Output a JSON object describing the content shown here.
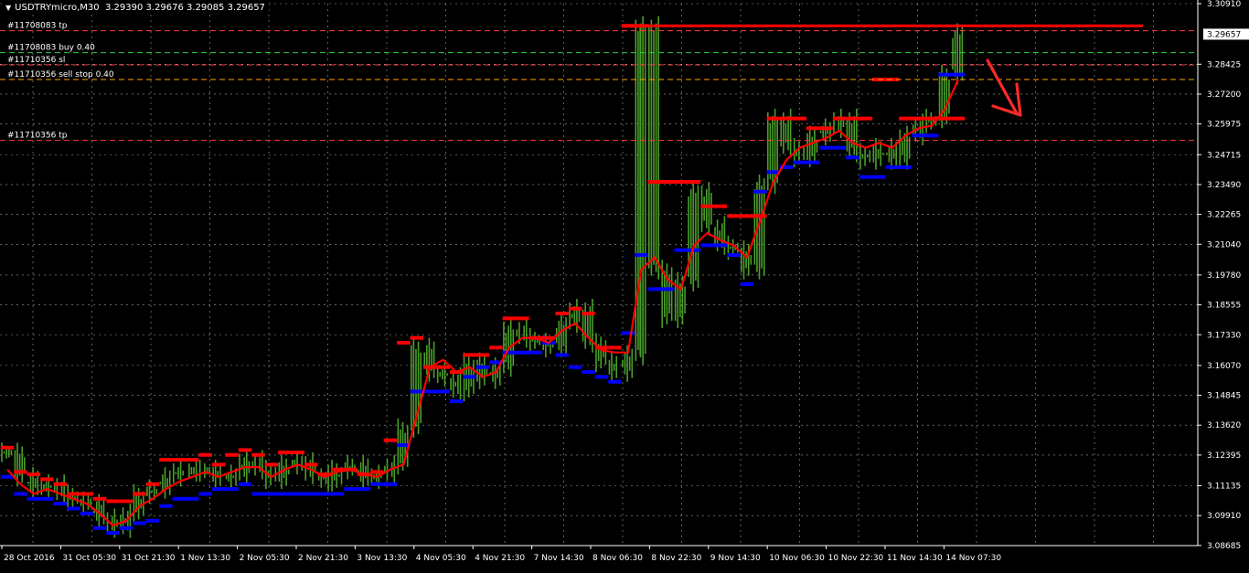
{
  "header": {
    "symbol": "USDTRYmicro,M30",
    "ohlc": "3.29390 3.29676 3.29085 3.29657"
  },
  "colors": {
    "background": "#000000",
    "grid": "#c8c8c8",
    "candle": "#4a9f2a",
    "resistance": "#ff0000",
    "support": "#0000ff",
    "ma": "#ff0000",
    "current_price_label_bg": "#ffffff"
  },
  "trade_lines": [
    {
      "label": "#11708083 tp",
      "price": 3.298,
      "color": "#ff3b3b",
      "style": "dashed"
    },
    {
      "label": "#11708083 buy 0.40",
      "price": 3.289,
      "color": "#2ecc40",
      "style": "dashed"
    },
    {
      "label": "#11710356 sl",
      "price": 3.284,
      "color": "#ff3b3b",
      "style": "dashed"
    },
    {
      "label": "#11710356 sell stop 0.40",
      "price": 3.278,
      "color": "#ffa500",
      "style": "dashed"
    },
    {
      "label": "#11710356 tp",
      "price": 3.253,
      "color": "#ff3b3b",
      "style": "dashed"
    }
  ],
  "current_price": "3.29657",
  "chart_data": {
    "type": "candlestick",
    "ylim": [
      3.0868,
      3.3091
    ],
    "y_ticks": [
      "3.30910",
      "3.28425",
      "3.27200",
      "3.25975",
      "3.24715",
      "3.23490",
      "3.22265",
      "3.21040",
      "3.19780",
      "3.18555",
      "3.17330",
      "3.16070",
      "3.14845",
      "3.13620",
      "3.12395",
      "3.11135",
      "3.09910",
      "3.08685"
    ],
    "y_tick_values": [
      3.3091,
      3.28425,
      3.272,
      3.25975,
      3.24715,
      3.2349,
      3.22265,
      3.2104,
      3.1978,
      3.18555,
      3.1733,
      3.1607,
      3.14845,
      3.1362,
      3.12395,
      3.11135,
      3.0991,
      3.08685
    ],
    "x_ticks": [
      "28 Oct 2016",
      "31 Oct 05:30",
      "31 Oct 21:30",
      "1 Nov 13:30",
      "2 Nov 05:30",
      "2 Nov 21:30",
      "3 Nov 13:30",
      "4 Nov 05:30",
      "4 Nov 21:30",
      "7 Nov 14:30",
      "8 Nov 06:30",
      "8 Nov 22:30",
      "9 Nov 14:30",
      "10 Nov 06:30",
      "10 Nov 22:30",
      "11 Nov 14:30",
      "14 Nov 07:30"
    ],
    "series": [
      {
        "name": "ma",
        "values": [
          3.118,
          3.112,
          3.108,
          3.11,
          3.108,
          3.106,
          3.104,
          3.1,
          3.095,
          3.097,
          3.103,
          3.106,
          3.11,
          3.113,
          3.115,
          3.117,
          3.115,
          3.117,
          3.119,
          3.119,
          3.115,
          3.118,
          3.12,
          3.118,
          3.115,
          3.117,
          3.118,
          3.116,
          3.115,
          3.118,
          3.12,
          3.14,
          3.16,
          3.163,
          3.158,
          3.16,
          3.156,
          3.158,
          3.168,
          3.172,
          3.172,
          3.17,
          3.175,
          3.178,
          3.172,
          3.167,
          3.166,
          3.166,
          3.2,
          3.205,
          3.196,
          3.192,
          3.21,
          3.215,
          3.212,
          3.21,
          3.205,
          3.22,
          3.236,
          3.245,
          3.25,
          3.252,
          3.254,
          3.257,
          3.252,
          3.25,
          3.252,
          3.25,
          3.255,
          3.258,
          3.259,
          3.266,
          3.278
        ]
      },
      {
        "name": "close",
        "values": [
          3.125,
          3.115,
          3.11,
          3.112,
          3.108,
          3.105,
          3.104,
          3.098,
          3.094,
          3.1,
          3.108,
          3.11,
          3.115,
          3.118,
          3.117,
          3.118,
          3.114,
          3.116,
          3.122,
          3.118,
          3.114,
          3.12,
          3.121,
          3.116,
          3.113,
          3.118,
          3.12,
          3.114,
          3.116,
          3.12,
          3.135,
          3.168,
          3.158,
          3.156,
          3.15,
          3.162,
          3.155,
          3.16,
          3.176,
          3.172,
          3.17,
          3.168,
          3.178,
          3.184,
          3.17,
          3.162,
          3.158,
          3.165,
          3.3,
          3.2,
          3.18,
          3.195,
          3.232,
          3.218,
          3.21,
          3.208,
          3.2,
          3.235,
          3.262,
          3.25,
          3.246,
          3.255,
          3.258,
          3.262,
          3.248,
          3.245,
          3.25,
          3.245,
          3.255,
          3.26,
          3.262,
          3.28,
          3.297
        ]
      },
      {
        "name": "resistance",
        "values": [
          3.127,
          3.117,
          3.116,
          3.114,
          3.112,
          3.108,
          3.108,
          3.106,
          3.105,
          3.105,
          3.108,
          3.112,
          3.122,
          3.122,
          3.122,
          3.124,
          3.12,
          3.124,
          3.126,
          3.124,
          3.12,
          3.125,
          3.125,
          3.12,
          3.116,
          3.118,
          3.118,
          3.116,
          3.117,
          3.13,
          3.17,
          3.172,
          3.16,
          3.16,
          3.158,
          3.165,
          3.165,
          3.168,
          3.18,
          3.18,
          3.172,
          3.172,
          3.182,
          3.184,
          3.182,
          3.168,
          3.168,
          3.3,
          3.3,
          3.236,
          3.236,
          3.236,
          3.236,
          3.226,
          3.226,
          3.222,
          3.222,
          3.222,
          3.262,
          3.262,
          3.262,
          3.258,
          3.258,
          3.262,
          3.262,
          3.262,
          3.278,
          3.278,
          3.262,
          3.262,
          3.262,
          3.262,
          3.262
        ]
      },
      {
        "name": "support",
        "values": [
          3.115,
          3.108,
          3.106,
          3.106,
          3.104,
          3.102,
          3.1,
          3.094,
          3.092,
          3.094,
          3.096,
          3.097,
          3.103,
          3.106,
          3.106,
          3.108,
          3.11,
          3.11,
          3.112,
          3.108,
          3.108,
          3.108,
          3.108,
          3.108,
          3.108,
          3.108,
          3.11,
          3.11,
          3.112,
          3.112,
          3.128,
          3.15,
          3.15,
          3.15,
          3.146,
          3.156,
          3.16,
          3.162,
          3.166,
          3.166,
          3.166,
          3.17,
          3.165,
          3.16,
          3.158,
          3.156,
          3.154,
          3.174,
          3.206,
          3.192,
          3.192,
          3.208,
          3.208,
          3.21,
          3.21,
          3.206,
          3.194,
          3.232,
          3.24,
          3.242,
          3.244,
          3.244,
          3.25,
          3.25,
          3.246,
          3.238,
          3.238,
          3.242,
          3.242,
          3.255,
          3.255,
          3.28,
          3.28
        ]
      }
    ]
  }
}
